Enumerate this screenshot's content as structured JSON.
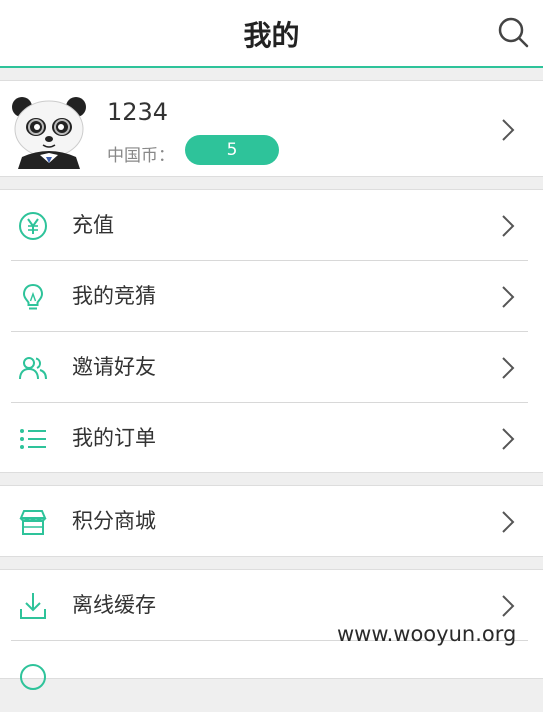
{
  "header": {
    "title": "我的"
  },
  "profile": {
    "username": "1234",
    "coin_label": "中国币：",
    "coin_value": "5"
  },
  "menu_group_1": [
    {
      "label": "充值",
      "icon": "yen-icon"
    },
    {
      "label": "我的竞猜",
      "icon": "lightbulb-icon"
    },
    {
      "label": "邀请好友",
      "icon": "users-icon"
    },
    {
      "label": "我的订单",
      "icon": "list-icon"
    }
  ],
  "menu_group_2": [
    {
      "label": "积分商城",
      "icon": "store-icon"
    }
  ],
  "menu_group_3": [
    {
      "label": "离线缓存",
      "icon": "download-icon"
    }
  ],
  "watermark": "www.wooyun.org",
  "colors": {
    "accent": "#2ec39a",
    "background": "#efefef"
  }
}
